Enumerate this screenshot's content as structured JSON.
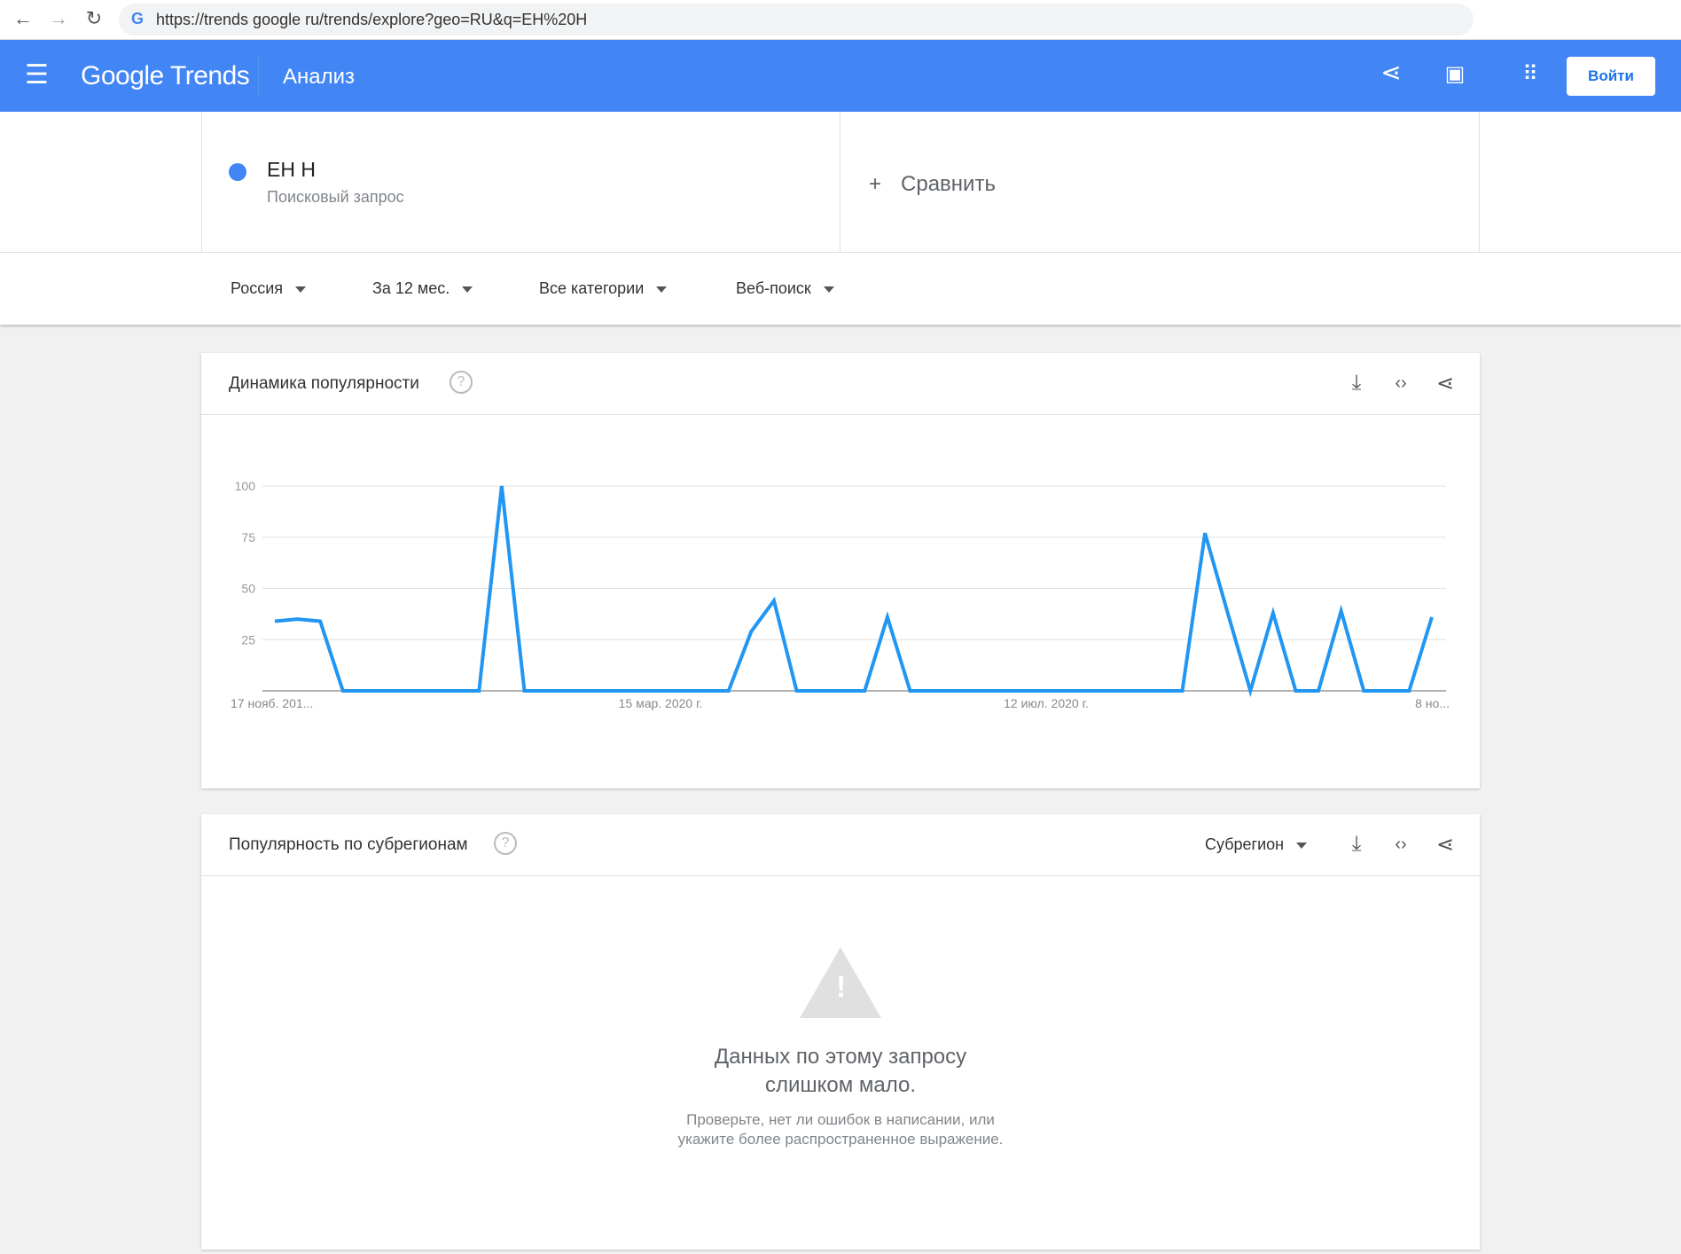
{
  "browser": {
    "url": "https://trends google ru/trends/explore?geo=RU&q=EH%20H"
  },
  "header": {
    "logo": "Google Trends",
    "title": "Анализ",
    "login": "Войти"
  },
  "search": {
    "term": "EH H",
    "term_type": "Поисковый запрос",
    "compare": "Сравнить",
    "term_color": "#4285f4"
  },
  "filters": [
    "Россия",
    "За 12 мес.",
    "Все категории",
    "Веб-поиск"
  ],
  "interest_card": {
    "title": "Динамика популярности"
  },
  "region_card": {
    "title": "Популярность по субрегионам",
    "resolution": "Субрегион",
    "empty_title": "Данных по этому запросу\nслишком мало.",
    "empty_sub": "Проверьте, нет ли ошибок в написании, или\nукажите более распространенное выражение."
  },
  "chart_data": {
    "type": "line",
    "title": "Динамика популярности",
    "xlabel": "",
    "ylabel": "",
    "ylim": [
      0,
      100
    ],
    "yticks": [
      25,
      50,
      75,
      100
    ],
    "xtick_labels": [
      {
        "index": 0,
        "label": "17 нояб. 201..."
      },
      {
        "index": 17,
        "label": "15 мар. 2020 г."
      },
      {
        "index": 34,
        "label": "12 июл. 2020 г."
      },
      {
        "index": 51,
        "label": "8 но..."
      }
    ],
    "series": [
      {
        "name": "EH H",
        "color": "#2196f3",
        "values": [
          34,
          35,
          34,
          0,
          0,
          0,
          0,
          0,
          0,
          0,
          100,
          0,
          0,
          0,
          0,
          0,
          0,
          0,
          0,
          0,
          0,
          29,
          44,
          0,
          0,
          0,
          0,
          36,
          0,
          0,
          0,
          0,
          0,
          0,
          0,
          0,
          0,
          0,
          0,
          0,
          0,
          77,
          38,
          0,
          38,
          0,
          0,
          39,
          0,
          0,
          0,
          36
        ]
      }
    ]
  }
}
